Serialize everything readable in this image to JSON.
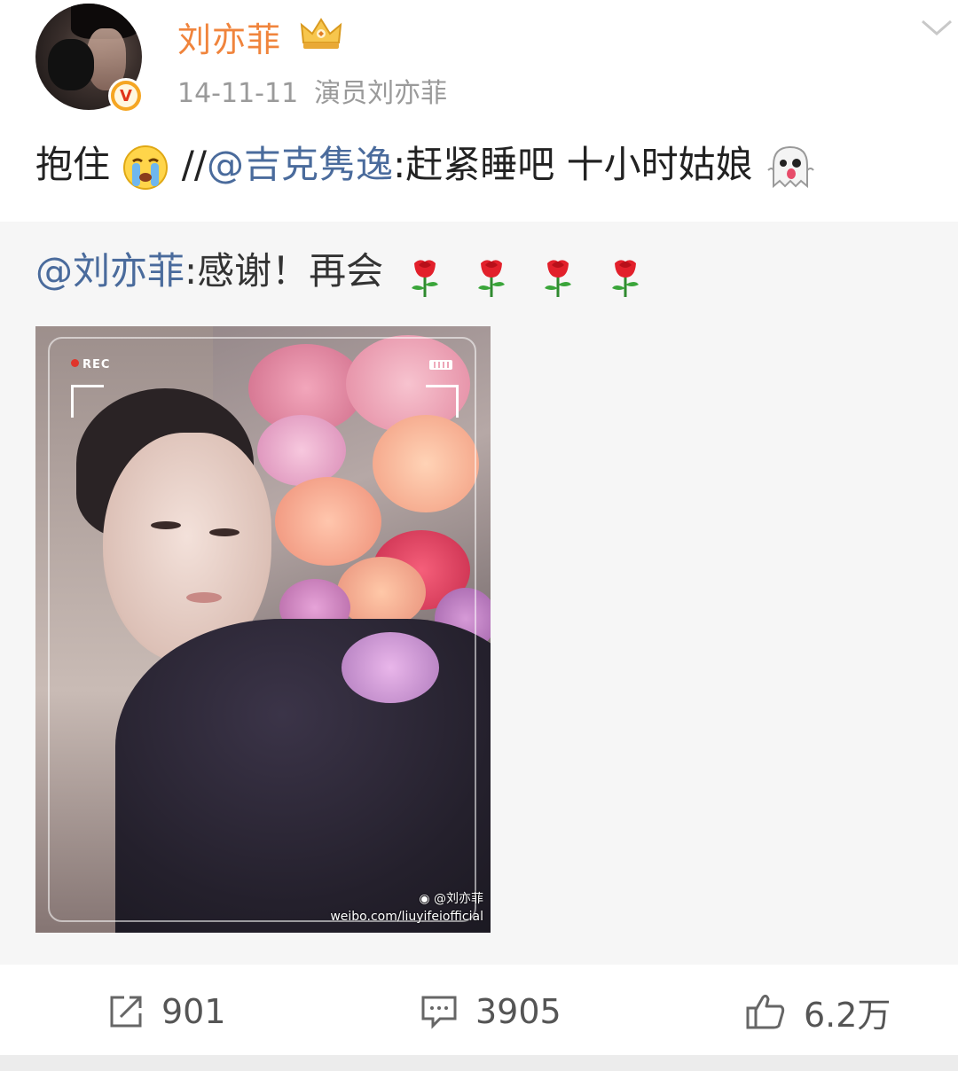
{
  "post": {
    "author": {
      "name": "刘亦菲",
      "avatar_icon": "avatar-photo",
      "verified_badge": "V",
      "member_icon": "crown-icon"
    },
    "date": "14-11-11",
    "source": "演员刘亦菲",
    "text_prefix": "抱住",
    "text_separator": "//",
    "mention": "@吉克隽逸",
    "text_after_mention": ":赶紧睡吧 十小时姑娘"
  },
  "repost": {
    "mention": "@刘亦菲",
    "text": ":感谢！再会",
    "rose_count": 4,
    "image": {
      "rec_label": "REC",
      "watermark_handle": "@刘亦菲",
      "watermark_url": "weibo.com/liuyifeiofficial"
    }
  },
  "actions": {
    "repost_count": "901",
    "comment_count": "3905",
    "like_count": "6.2万"
  },
  "colors": {
    "username": "#f0843c",
    "mention": "#4a6b9c",
    "meta": "#9a9a9a",
    "repost_bg": "#f6f6f6"
  }
}
